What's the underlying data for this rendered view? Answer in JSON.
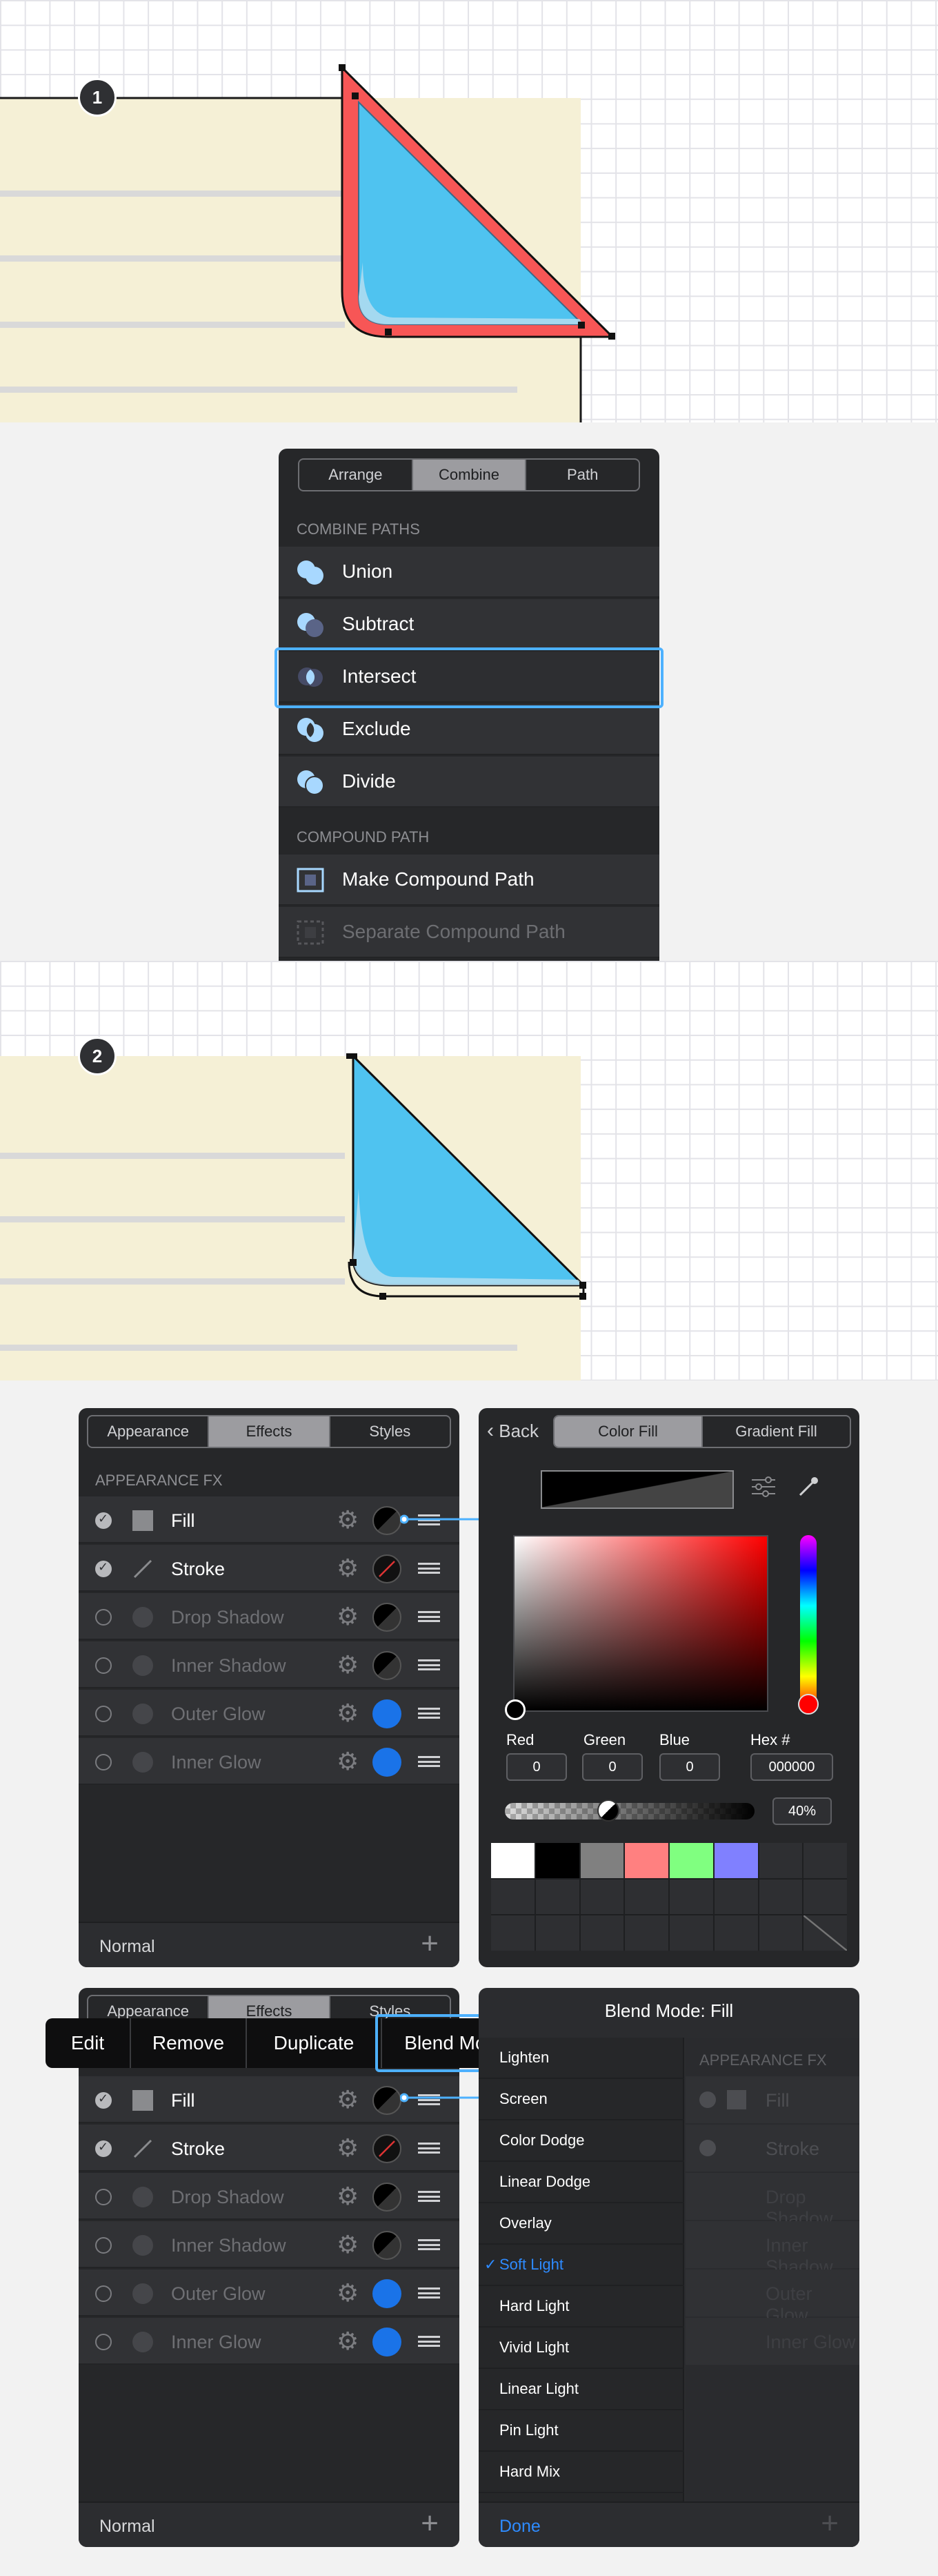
{
  "steps": {
    "first": "1",
    "second": "2"
  },
  "combine_panel": {
    "tabs": [
      "Arrange",
      "Combine",
      "Path"
    ],
    "active_tab": "Combine",
    "section_combine": "COMBINE PATHS",
    "items": [
      "Union",
      "Subtract",
      "Intersect",
      "Exclude",
      "Divide"
    ],
    "highlighted": "Intersect",
    "section_compound": "COMPOUND PATH",
    "compound_items": [
      "Make Compound Path",
      "Separate Compound Path"
    ]
  },
  "appearance_panel": {
    "tabs": [
      "Appearance",
      "Effects",
      "Styles"
    ],
    "active_tab": "Effects",
    "section": "APPEARANCE FX",
    "rows": [
      {
        "label": "Fill",
        "enabled": true,
        "swatch": "#000000"
      },
      {
        "label": "Stroke",
        "enabled": true,
        "swatch": "#000000"
      },
      {
        "label": "Drop Shadow",
        "enabled": false,
        "swatch": "#000000"
      },
      {
        "label": "Inner Shadow",
        "enabled": false,
        "swatch": "#000000"
      },
      {
        "label": "Outer Glow",
        "enabled": false,
        "swatch": "#1a73e8"
      },
      {
        "label": "Inner Glow",
        "enabled": false,
        "swatch": "#1a73e8"
      }
    ],
    "footer": "Normal"
  },
  "color_panel": {
    "back": "Back",
    "tabs": [
      "Color Fill",
      "Gradient Fill"
    ],
    "active_tab": "Color Fill",
    "labels": {
      "red": "Red",
      "green": "Green",
      "blue": "Blue",
      "hex": "Hex #"
    },
    "values": {
      "red": "0",
      "green": "0",
      "blue": "0",
      "hex": "000000"
    },
    "opacity": "40%",
    "opacity_fraction": 0.4,
    "swatches": [
      "#ffffff",
      "#000000",
      "#808080",
      "#ff8080",
      "#80ff80",
      "#8080ff"
    ]
  },
  "context_menu": {
    "items": [
      "Edit",
      "Remove",
      "Duplicate",
      "Blend Mode"
    ],
    "highlighted": "Blend Mode"
  },
  "blend_panel": {
    "title": "Blend Mode: Fill",
    "modes": [
      "Lighten",
      "Screen",
      "Color Dodge",
      "Linear Dodge",
      "Overlay",
      "Soft Light",
      "Hard Light",
      "Vivid Light",
      "Linear Light",
      "Pin Light",
      "Hard Mix"
    ],
    "selected": "Soft Light",
    "check": "✓",
    "done": "Done",
    "behind_section": "APPEARANCE FX",
    "behind_rows": [
      "Fill",
      "Stroke",
      "Drop Shadow",
      "Inner Shadow",
      "Outer Glow",
      "Inner Glow"
    ]
  },
  "colors": {
    "accent_blue": "#4db1ff",
    "shape_fill": "#4fc3f0",
    "stroke_red": "#f75656",
    "paper": "#f5f0d6"
  }
}
